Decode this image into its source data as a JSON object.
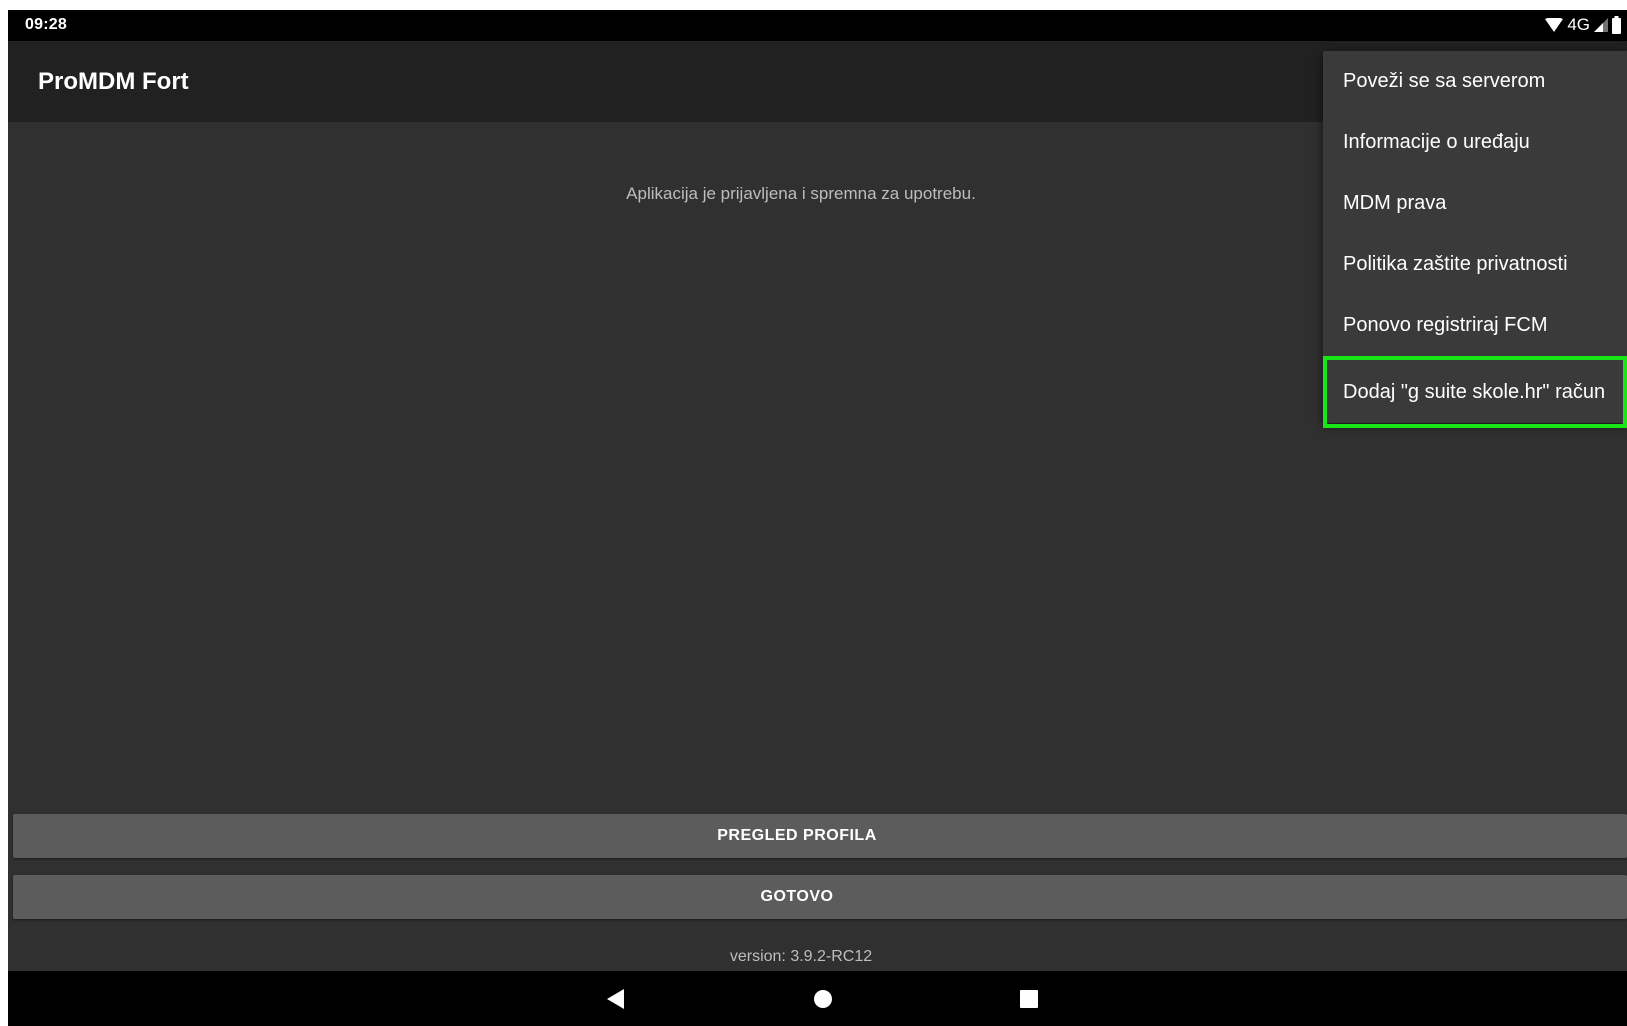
{
  "status_bar": {
    "time": "09:28",
    "network_label": "4G",
    "icons": [
      "wifi-icon",
      "cellular-signal-icon",
      "battery-icon"
    ]
  },
  "app_bar": {
    "title": "ProMDM Fort"
  },
  "main": {
    "status_message": "Aplikacija je prijavljena i spremna za upotrebu.",
    "profile_button_label": "PREGLED PROFILA",
    "done_button_label": "GOTOVO",
    "version_text": "version: 3.9.2-RC12"
  },
  "overflow_menu": {
    "items": [
      {
        "label": "Poveži se sa serverom"
      },
      {
        "label": "Informacije o uređaju"
      },
      {
        "label": "MDM prava"
      },
      {
        "label": "Politika zaštite privatnosti"
      },
      {
        "label": "Ponovo registriraj FCM"
      },
      {
        "label": "Dodaj \"g suite skole.hr\" račun",
        "highlighted": true
      }
    ]
  },
  "navigation_bar": {
    "icons": [
      "back-icon",
      "home-icon",
      "recents-icon"
    ]
  },
  "colors": {
    "background": "#303030",
    "app_bar": "#212121",
    "button": "#5c5c5c",
    "menu": "#3a3a3a",
    "highlight": "#19e619"
  }
}
